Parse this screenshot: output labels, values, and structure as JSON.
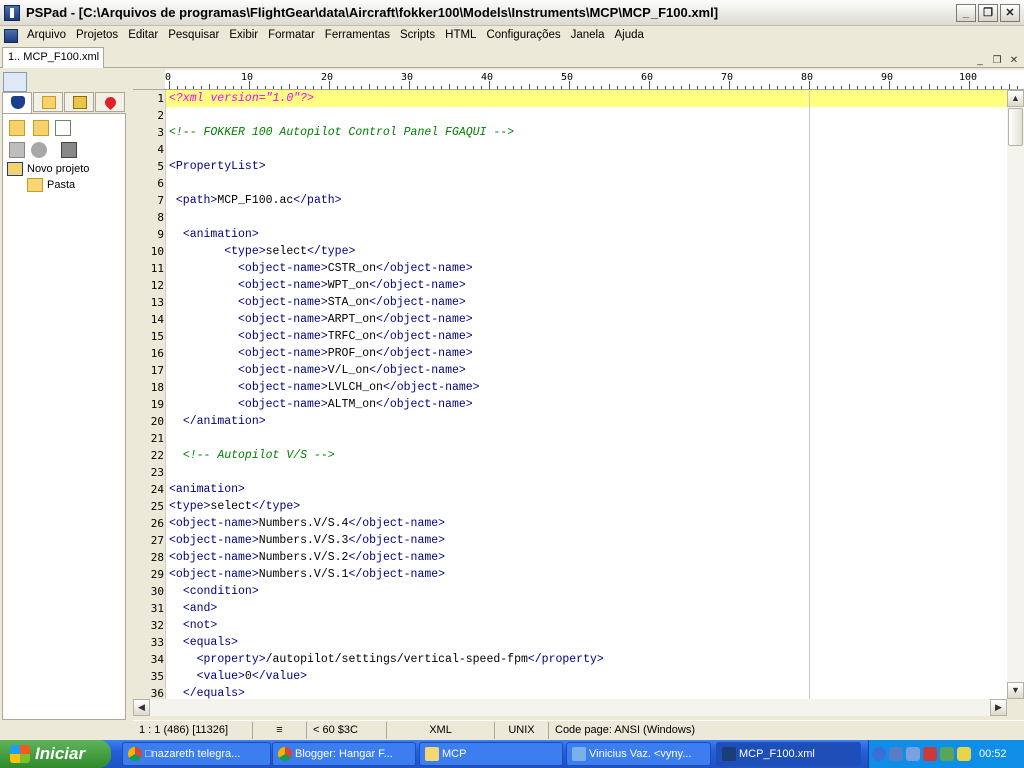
{
  "window": {
    "title": "PSPad - [C:\\Arquivos de programas\\FlightGear\\data\\Aircraft\\fokker100\\Models\\Instruments\\MCP\\MCP_F100.xml]",
    "minimize_icon": "minimize-icon",
    "restore_icon": "restore-icon",
    "close_icon": "close-icon"
  },
  "menu": {
    "items": [
      "Arquivo",
      "Projetos",
      "Editar",
      "Pesquisar",
      "Exibir",
      "Formatar",
      "Ferramentas",
      "Scripts",
      "HTML",
      "Configurações",
      "Janela",
      "Ajuda"
    ]
  },
  "tabs": {
    "file_tab": "1.. MCP_F100.xml"
  },
  "project": {
    "root": "Novo projeto",
    "folder": "Pasta"
  },
  "ruler": {
    "labels": [
      "0",
      "10",
      "20",
      "30",
      "40",
      "50",
      "60",
      "70",
      "80",
      "90",
      "100"
    ]
  },
  "editor": {
    "current_line": 1,
    "lines": [
      {
        "n": "1",
        "segs": [
          [
            "pi",
            "<?xml version=\"1.0\"?>"
          ]
        ]
      },
      {
        "n": "2",
        "segs": []
      },
      {
        "n": "3",
        "segs": [
          [
            "c",
            "<!-- FOKKER 100 Autopilot Control Panel FGAQUI -->"
          ]
        ]
      },
      {
        "n": "4",
        "segs": []
      },
      {
        "n": "5",
        "segs": [
          [
            "t",
            "<PropertyList>"
          ]
        ]
      },
      {
        "n": "6",
        "segs": []
      },
      {
        "n": "7",
        "segs": [
          [
            "x",
            " "
          ],
          [
            "t",
            "<path>"
          ],
          [
            "x",
            "MCP_F100.ac"
          ],
          [
            "t",
            "</path>"
          ]
        ]
      },
      {
        "n": "8",
        "segs": []
      },
      {
        "n": "9",
        "segs": [
          [
            "x",
            "  "
          ],
          [
            "t",
            "<animation>"
          ]
        ]
      },
      {
        "n": "10",
        "segs": [
          [
            "x",
            "        "
          ],
          [
            "t",
            "<type>"
          ],
          [
            "x",
            "select"
          ],
          [
            "t",
            "</type>"
          ]
        ]
      },
      {
        "n": "11",
        "segs": [
          [
            "x",
            "          "
          ],
          [
            "t",
            "<object-name>"
          ],
          [
            "x",
            "CSTR_on"
          ],
          [
            "t",
            "</object-name>"
          ]
        ]
      },
      {
        "n": "12",
        "segs": [
          [
            "x",
            "          "
          ],
          [
            "t",
            "<object-name>"
          ],
          [
            "x",
            "WPT_on"
          ],
          [
            "t",
            "</object-name>"
          ]
        ]
      },
      {
        "n": "13",
        "segs": [
          [
            "x",
            "          "
          ],
          [
            "t",
            "<object-name>"
          ],
          [
            "x",
            "STA_on"
          ],
          [
            "t",
            "</object-name>"
          ]
        ]
      },
      {
        "n": "14",
        "segs": [
          [
            "x",
            "          "
          ],
          [
            "t",
            "<object-name>"
          ],
          [
            "x",
            "ARPT_on"
          ],
          [
            "t",
            "</object-name>"
          ]
        ]
      },
      {
        "n": "15",
        "segs": [
          [
            "x",
            "          "
          ],
          [
            "t",
            "<object-name>"
          ],
          [
            "x",
            "TRFC_on"
          ],
          [
            "t",
            "</object-name>"
          ]
        ]
      },
      {
        "n": "16",
        "segs": [
          [
            "x",
            "          "
          ],
          [
            "t",
            "<object-name>"
          ],
          [
            "x",
            "PROF_on"
          ],
          [
            "t",
            "</object-name>"
          ]
        ]
      },
      {
        "n": "17",
        "segs": [
          [
            "x",
            "          "
          ],
          [
            "t",
            "<object-name>"
          ],
          [
            "x",
            "V/L_on"
          ],
          [
            "t",
            "</object-name>"
          ]
        ]
      },
      {
        "n": "18",
        "segs": [
          [
            "x",
            "          "
          ],
          [
            "t",
            "<object-name>"
          ],
          [
            "x",
            "LVLCH_on"
          ],
          [
            "t",
            "</object-name>"
          ]
        ]
      },
      {
        "n": "19",
        "segs": [
          [
            "x",
            "          "
          ],
          [
            "t",
            "<object-name>"
          ],
          [
            "x",
            "ALTM_on"
          ],
          [
            "t",
            "</object-name>"
          ]
        ]
      },
      {
        "n": "20",
        "segs": [
          [
            "x",
            "  "
          ],
          [
            "t",
            "</animation>"
          ]
        ]
      },
      {
        "n": "21",
        "segs": []
      },
      {
        "n": "22",
        "segs": [
          [
            "x",
            "  "
          ],
          [
            "c",
            "<!-- Autopilot V/S -->"
          ]
        ]
      },
      {
        "n": "23",
        "segs": []
      },
      {
        "n": "24",
        "segs": [
          [
            "t",
            "<animation>"
          ]
        ]
      },
      {
        "n": "25",
        "segs": [
          [
            "t",
            "<type>"
          ],
          [
            "x",
            "select"
          ],
          [
            "t",
            "</type>"
          ]
        ]
      },
      {
        "n": "26",
        "segs": [
          [
            "t",
            "<object-name>"
          ],
          [
            "x",
            "Numbers.V/S.4"
          ],
          [
            "t",
            "</object-name>"
          ]
        ]
      },
      {
        "n": "27",
        "segs": [
          [
            "t",
            "<object-name>"
          ],
          [
            "x",
            "Numbers.V/S.3"
          ],
          [
            "t",
            "</object-name>"
          ]
        ]
      },
      {
        "n": "28",
        "segs": [
          [
            "t",
            "<object-name>"
          ],
          [
            "x",
            "Numbers.V/S.2"
          ],
          [
            "t",
            "</object-name>"
          ]
        ]
      },
      {
        "n": "29",
        "segs": [
          [
            "t",
            "<object-name>"
          ],
          [
            "x",
            "Numbers.V/S.1"
          ],
          [
            "t",
            "</object-name>"
          ]
        ]
      },
      {
        "n": "30",
        "segs": [
          [
            "x",
            "  "
          ],
          [
            "t",
            "<condition>"
          ]
        ]
      },
      {
        "n": "31",
        "segs": [
          [
            "x",
            "  "
          ],
          [
            "t",
            "<and>"
          ]
        ]
      },
      {
        "n": "32",
        "segs": [
          [
            "x",
            "  "
          ],
          [
            "t",
            "<not>"
          ]
        ]
      },
      {
        "n": "33",
        "segs": [
          [
            "x",
            "  "
          ],
          [
            "t",
            "<equals>"
          ]
        ]
      },
      {
        "n": "34",
        "segs": [
          [
            "x",
            "    "
          ],
          [
            "t",
            "<property>"
          ],
          [
            "x",
            "/autopilot/settings/vertical-speed-fpm"
          ],
          [
            "t",
            "</property>"
          ]
        ]
      },
      {
        "n": "35",
        "segs": [
          [
            "x",
            "    "
          ],
          [
            "t",
            "<value>"
          ],
          [
            "x",
            "0"
          ],
          [
            "t",
            "</value>"
          ]
        ]
      },
      {
        "n": "36",
        "segs": [
          [
            "x",
            "  "
          ],
          [
            "t",
            "</equals>"
          ]
        ]
      }
    ]
  },
  "statusbar": {
    "position": "1 : 1  (486)  [11326]",
    "col_info": "<  60  $3C",
    "syntax": "XML",
    "line_end": "UNIX",
    "codepage": "Code page: ANSI (Windows)"
  },
  "taskbar": {
    "start": "Iniciar",
    "tasks": [
      "□nazareth telegra...",
      "Blogger: Hangar F...",
      "MCP",
      "Vinicius Vaz. <vyny...",
      "MCP_F100.xml"
    ],
    "clock": "00:52"
  },
  "colors": {
    "tag": "#000080",
    "comment": "#008000",
    "pi": "#ff00ff",
    "current_line": "#ffff80"
  }
}
